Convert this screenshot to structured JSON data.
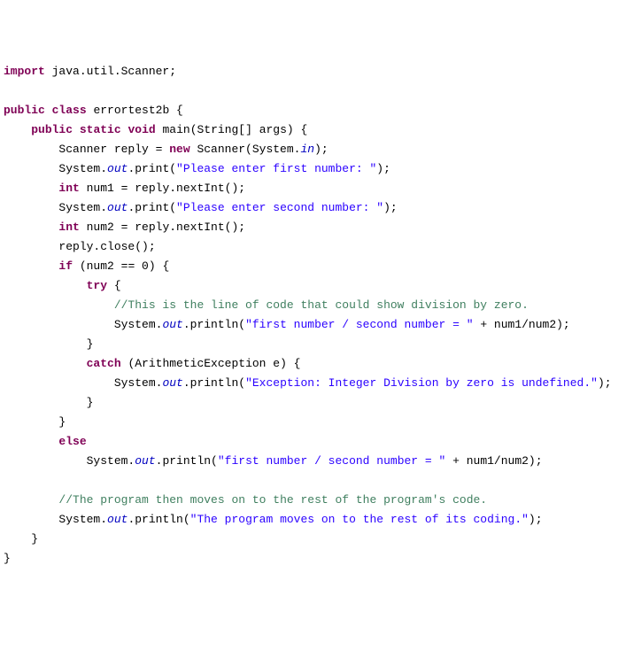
{
  "lines": [
    [
      {
        "cls": "kw",
        "t": "import"
      },
      {
        "cls": "text",
        "t": " java.util.Scanner;"
      }
    ],
    [
      {
        "cls": "text",
        "t": ""
      }
    ],
    [
      {
        "cls": "kw",
        "t": "public"
      },
      {
        "cls": "text",
        "t": " "
      },
      {
        "cls": "kw",
        "t": "class"
      },
      {
        "cls": "text",
        "t": " errortest2b {"
      }
    ],
    [
      {
        "cls": "text",
        "t": "    "
      },
      {
        "cls": "kw",
        "t": "public"
      },
      {
        "cls": "text",
        "t": " "
      },
      {
        "cls": "kw",
        "t": "static"
      },
      {
        "cls": "text",
        "t": " "
      },
      {
        "cls": "kw",
        "t": "void"
      },
      {
        "cls": "text",
        "t": " main(String[] args) {"
      }
    ],
    [
      {
        "cls": "text",
        "t": "        Scanner reply = "
      },
      {
        "cls": "kw",
        "t": "new"
      },
      {
        "cls": "text",
        "t": " Scanner(System."
      },
      {
        "cls": "fld",
        "t": "in"
      },
      {
        "cls": "text",
        "t": ");"
      }
    ],
    [
      {
        "cls": "text",
        "t": "        System."
      },
      {
        "cls": "fld",
        "t": "out"
      },
      {
        "cls": "text",
        "t": ".print("
      },
      {
        "cls": "str",
        "t": "\"Please enter first number: \""
      },
      {
        "cls": "text",
        "t": ");"
      }
    ],
    [
      {
        "cls": "text",
        "t": "        "
      },
      {
        "cls": "kw",
        "t": "int"
      },
      {
        "cls": "text",
        "t": " num1 = reply.nextInt();"
      }
    ],
    [
      {
        "cls": "text",
        "t": "        System."
      },
      {
        "cls": "fld",
        "t": "out"
      },
      {
        "cls": "text",
        "t": ".print("
      },
      {
        "cls": "str",
        "t": "\"Please enter second number: \""
      },
      {
        "cls": "text",
        "t": ");"
      }
    ],
    [
      {
        "cls": "text",
        "t": "        "
      },
      {
        "cls": "kw",
        "t": "int"
      },
      {
        "cls": "text",
        "t": " num2 = reply.nextInt();"
      }
    ],
    [
      {
        "cls": "text",
        "t": "        reply.close();"
      }
    ],
    [
      {
        "cls": "text",
        "t": "        "
      },
      {
        "cls": "kw",
        "t": "if"
      },
      {
        "cls": "text",
        "t": " (num2 == 0) {"
      }
    ],
    [
      {
        "cls": "text",
        "t": "            "
      },
      {
        "cls": "kw",
        "t": "try"
      },
      {
        "cls": "text",
        "t": " {"
      }
    ],
    [
      {
        "cls": "text",
        "t": "                "
      },
      {
        "cls": "com",
        "t": "//This is the line of code that could show division by zero."
      }
    ],
    [
      {
        "cls": "text",
        "t": "                System."
      },
      {
        "cls": "fld",
        "t": "out"
      },
      {
        "cls": "text",
        "t": ".println("
      },
      {
        "cls": "str",
        "t": "\"first number / second number = \""
      },
      {
        "cls": "text",
        "t": " + num1/num2);"
      }
    ],
    [
      {
        "cls": "text",
        "t": "            }"
      }
    ],
    [
      {
        "cls": "text",
        "t": "            "
      },
      {
        "cls": "kw",
        "t": "catch"
      },
      {
        "cls": "text",
        "t": " (ArithmeticException e) {"
      }
    ],
    [
      {
        "cls": "text",
        "t": "                System."
      },
      {
        "cls": "fld",
        "t": "out"
      },
      {
        "cls": "text",
        "t": ".println("
      },
      {
        "cls": "str",
        "t": "\"Exception: Integer Division by zero is undefined.\""
      },
      {
        "cls": "text",
        "t": ");"
      }
    ],
    [
      {
        "cls": "text",
        "t": "            }"
      }
    ],
    [
      {
        "cls": "text",
        "t": "        }"
      }
    ],
    [
      {
        "cls": "text",
        "t": "        "
      },
      {
        "cls": "kw",
        "t": "else"
      }
    ],
    [
      {
        "cls": "text",
        "t": "            System."
      },
      {
        "cls": "fld",
        "t": "out"
      },
      {
        "cls": "text",
        "t": ".println("
      },
      {
        "cls": "str",
        "t": "\"first number / second number = \""
      },
      {
        "cls": "text",
        "t": " + num1/num2);"
      }
    ],
    [
      {
        "cls": "text",
        "t": ""
      }
    ],
    [
      {
        "cls": "text",
        "t": "        "
      },
      {
        "cls": "com",
        "t": "//The program then moves on to the rest of the program's code."
      }
    ],
    [
      {
        "cls": "text",
        "t": "        System."
      },
      {
        "cls": "fld",
        "t": "out"
      },
      {
        "cls": "text",
        "t": ".println("
      },
      {
        "cls": "str",
        "t": "\"The program moves on to the rest of its coding.\""
      },
      {
        "cls": "text",
        "t": ");"
      }
    ],
    [
      {
        "cls": "text",
        "t": "    }"
      }
    ],
    [
      {
        "cls": "text",
        "t": "}"
      }
    ]
  ]
}
